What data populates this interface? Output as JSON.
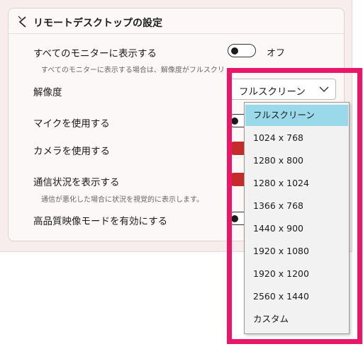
{
  "colors": {
    "accent_red": "#c42b2b",
    "highlight_pink": "#ea1768",
    "selected_item": "#99d9ea"
  },
  "section": {
    "title": "リモートデスクトップの設定",
    "back_icon": "chevron-left-icon"
  },
  "settings": {
    "all_monitors": {
      "label": "すべてのモニターに表示する",
      "description": "すべてのモニターに表示する場合は、解像度がフルスクリ",
      "toggle_state": "off",
      "toggle_text": "オフ"
    },
    "resolution": {
      "label": "解像度",
      "selected_value": "フルスクリーン"
    },
    "microphone": {
      "label": "マイクを使用する",
      "toggle_state": "off"
    },
    "camera": {
      "label": "カメラを使用する",
      "toggle_state": "on"
    },
    "connection_status": {
      "label": "通信状況を表示する",
      "description": "通信が悪化した場合に状況を視覚的に表示します。",
      "toggle_state": "on"
    },
    "high_quality": {
      "label": "高品質映像モードを有効にする",
      "toggle_state": "off"
    }
  },
  "resolution_options": [
    "フルスクリーン",
    "1024 x 768",
    "1280 x 800",
    "1280 x 1024",
    "1366 x 768",
    "1440 x 900",
    "1920 x 1080",
    "1920 x 1200",
    "2560 x 1440",
    "カスタム"
  ],
  "selected_option_index": 0
}
